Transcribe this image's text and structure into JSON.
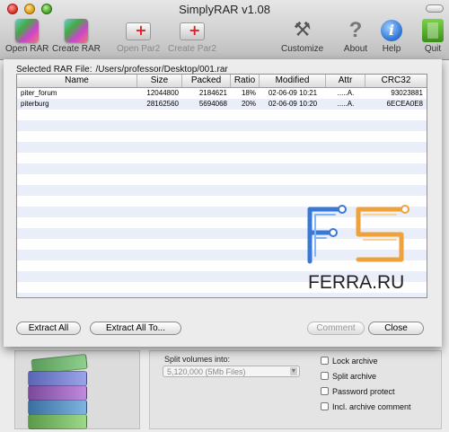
{
  "window": {
    "title": "SimplyRAR v1.08"
  },
  "toolbar": {
    "open_rar": "Open RAR",
    "create_rar": "Create RAR",
    "open_par2": "Open Par2",
    "create_par2": "Create Par2",
    "customize": "Customize",
    "about": "About",
    "help": "Help",
    "quit": "Quit"
  },
  "sheet": {
    "selected_label": "Selected RAR File:",
    "selected_path": "/Users/professor/Desktop/001.rar",
    "columns": [
      "Name",
      "Size",
      "Packed",
      "Ratio",
      "Modified",
      "Attr",
      "CRC32"
    ],
    "rows": [
      [
        "piter_forum",
        "12044800",
        "2184621",
        "18%",
        "02-06-09 10:21",
        ".....A.",
        "93023881"
      ],
      [
        "piterburg",
        "28162560",
        "5694068",
        "20%",
        "02-06-09 10:20",
        ".....A.",
        "6ECEA0E8"
      ]
    ],
    "buttons": {
      "extract_all": "Extract All",
      "extract_all_to": "Extract All To...",
      "comment": "Comment",
      "close": "Close"
    },
    "watermark": "FERRA.RU"
  },
  "bottom": {
    "split_label": "Split volumes into:",
    "split_value": "5,120,000 (5Mb Files)",
    "options": [
      "Lock archive",
      "Split archive",
      "Password protect",
      "Incl. archive comment"
    ]
  },
  "colors": {
    "row_stripe": "#e9eef8",
    "logo_blue": "#3a78d6",
    "logo_orange": "#f0a23a"
  }
}
